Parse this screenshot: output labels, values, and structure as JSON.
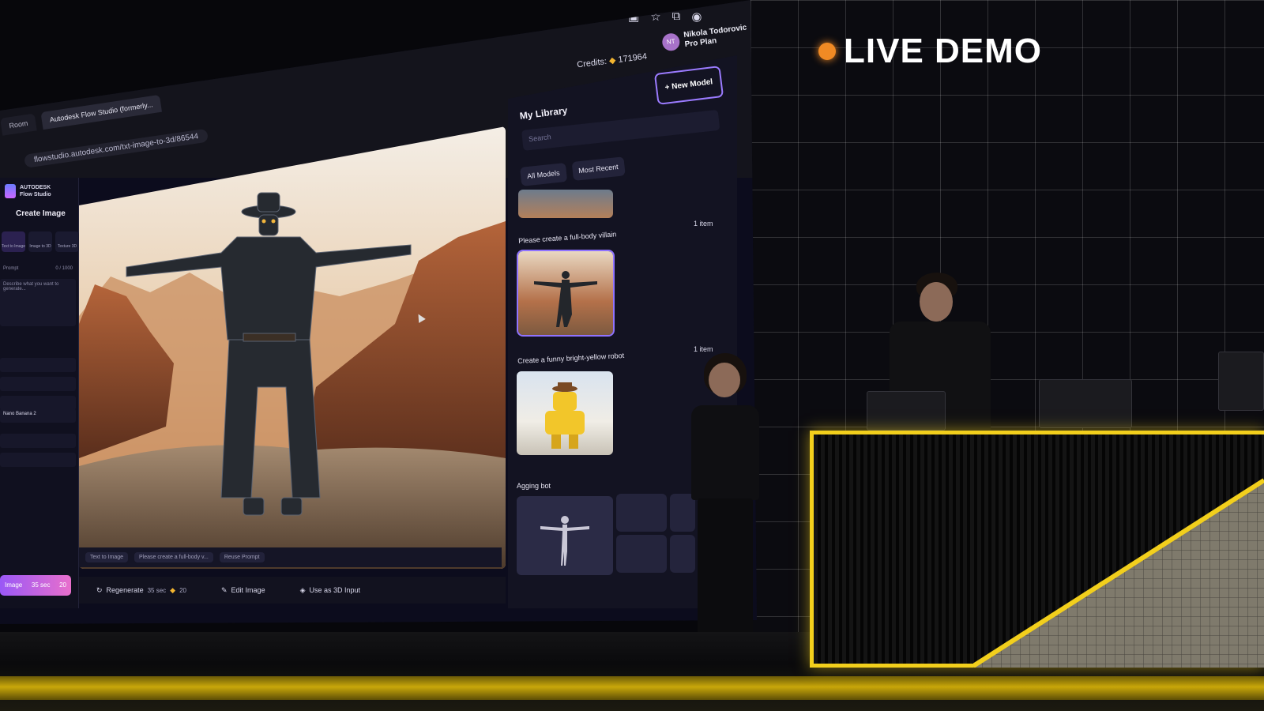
{
  "browser": {
    "tabs": [
      {
        "label": "Room"
      },
      {
        "label": "Autodesk Flow Studio (formerly..."
      }
    ],
    "url": "flowstudio.autodesk.com/txt-image-to-3d/86544",
    "icons": [
      "cast-icon",
      "star-icon",
      "extensions-icon",
      "profile-icon"
    ]
  },
  "header": {
    "credits_label": "Credits:",
    "credits_value": "171964",
    "user_name": "Nikola Todorovic",
    "user_plan": "Pro Plan",
    "avatar_initials": "NT"
  },
  "sidebar": {
    "brand_line1": "AUTODESK",
    "brand_line2": "Flow Studio",
    "title": "Create Image",
    "modes": [
      {
        "label": "Text to Image"
      },
      {
        "label": "Image to 3D"
      },
      {
        "label": "Texture 3D"
      }
    ],
    "prompt_label": "Prompt",
    "prompt_count": "0 / 1000",
    "prompt_placeholder": "Describe what you want to generate...",
    "model_value": "Nano Banana 2",
    "generate_label": "Image",
    "generate_time": "35 sec",
    "generate_cost": "20"
  },
  "main": {
    "chips": [
      "Text to Image",
      "Please create a full-body v...",
      "Reuse Prompt"
    ],
    "actions": {
      "regenerate": "Regenerate",
      "time": "35 sec",
      "cost": "20",
      "edit": "Edit Image",
      "use3d": "Use as 3D Input"
    }
  },
  "library": {
    "title": "My Library",
    "new_model": "New Model",
    "search_placeholder": "Search",
    "filters": [
      "All Models",
      "Most Recent"
    ],
    "items": [
      {
        "label": "Please create a full-body villain",
        "count": "1 item"
      },
      {
        "label": "Create a funny bright-yellow robot",
        "count": "1 item"
      },
      {
        "label": "Agging bot",
        "count": ""
      }
    ]
  },
  "stage": {
    "live_label": "LIVE DEMO",
    "accent": "#f2cf1c",
    "live_dot": "#f08a24"
  }
}
